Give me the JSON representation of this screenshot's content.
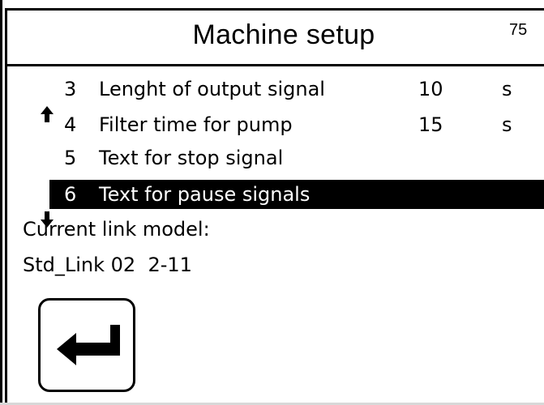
{
  "header": {
    "title": "Machine setup",
    "corner_number": "75"
  },
  "menu": {
    "items": [
      {
        "arrow": "🠉",
        "arrow_icon": "arrow-up-icon",
        "number": "3",
        "label": "Lenght of output signal",
        "value": "10",
        "unit": "s",
        "selected": false
      },
      {
        "arrow": "",
        "number": "4",
        "label": "Filter time for pump",
        "value": "15",
        "unit": "s",
        "selected": false
      },
      {
        "arrow": "",
        "number": "5",
        "label": "Text for stop signal",
        "value": "",
        "unit": "",
        "selected": false
      },
      {
        "arrow": "🠋",
        "arrow_icon": "arrow-down-icon",
        "number": "6",
        "label": "Text for pause signals",
        "value": "",
        "unit": "",
        "selected": true
      }
    ]
  },
  "info": {
    "line1": "Current link model:",
    "line2": "Std_Link 02  2-11"
  },
  "enter_button": {
    "icon": "enter-return-icon"
  },
  "colors": {
    "background": "#ffffff",
    "foreground": "#000000",
    "highlight_bg": "#000000",
    "highlight_fg": "#ffffff"
  }
}
